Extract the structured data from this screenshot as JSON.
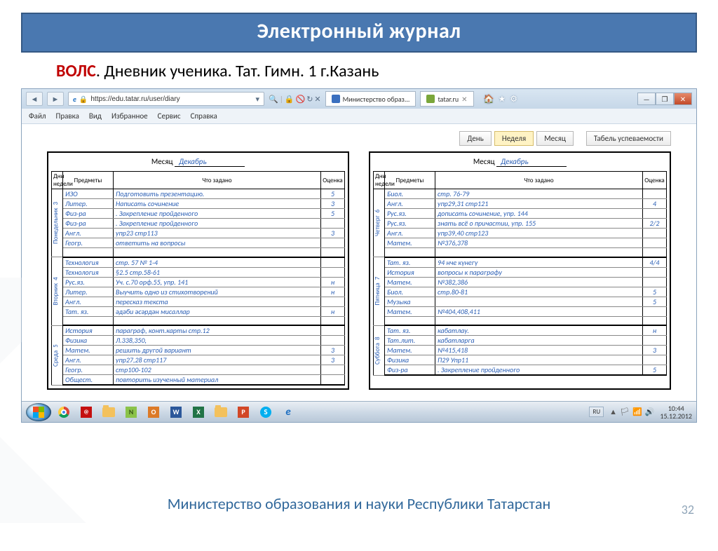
{
  "slide": {
    "title": "Электронный журнал",
    "subtitle_red": "ВОЛС",
    "subtitle_rest": ".  Дневник ученика. Тат. Гимн. 1  г.Казань",
    "footer": "Министерство образования и науки Республики Татарстан",
    "number": "32"
  },
  "browser": {
    "url": "https://edu.tatar.ru/user/diary",
    "tabs": [
      {
        "label": "Министерство образ..."
      },
      {
        "label": "tatar.ru"
      }
    ],
    "menu": [
      "Файл",
      "Правка",
      "Вид",
      "Избранное",
      "Сервис",
      "Справка"
    ],
    "view_buttons": {
      "day": "День",
      "week": "Неделя",
      "month": "Месяц",
      "report": "Табель успеваемости"
    },
    "month_label": "Месяц",
    "month_value": "Декабрь",
    "headers": {
      "day": "Дни недели",
      "subject": "Предметы",
      "task": "Что задано",
      "grade": "Оценка"
    }
  },
  "left_page": [
    {
      "day": "Понедельник",
      "num": "3",
      "rows": [
        {
          "s": "ИЗО",
          "t": "Подготовить презентацию.",
          "g": "5"
        },
        {
          "s": "Литер.",
          "t": "Написать сочинение",
          "g": "3"
        },
        {
          "s": "Физ-ра",
          "t": ". Закрепление пройденного",
          "g": "5"
        },
        {
          "s": "Физ-ра",
          "t": ". Закрепление пройденного",
          "g": ""
        },
        {
          "s": "Англ.",
          "t": "упр23 стр113",
          "g": "3"
        },
        {
          "s": "Геогр.",
          "t": "ответить на вопросы",
          "g": ""
        },
        {
          "s": "",
          "t": "",
          "g": ""
        }
      ]
    },
    {
      "day": "Вторник",
      "num": "4",
      "rows": [
        {
          "s": "Технология",
          "t": "стр. 57 № 1-4",
          "g": ""
        },
        {
          "s": "Технология",
          "t": "§2.5 стр.58-61",
          "g": ""
        },
        {
          "s": "Рус.яз.",
          "t": "Уч. с.70 орф.55, упр. 141",
          "g": "н"
        },
        {
          "s": "Литер.",
          "t": "Выучить одно из стихотворений",
          "g": "н"
        },
        {
          "s": "Англ.",
          "t": "пересказ текста",
          "g": ""
        },
        {
          "s": "Тат. яз.",
          "t": "әдәби әсәрдән мисаллар",
          "g": "н"
        },
        {
          "s": "",
          "t": "",
          "g": ""
        }
      ]
    },
    {
      "day": "Среда",
      "num": "5",
      "rows": [
        {
          "s": "История",
          "t": "параграф, конт.карты стр.12",
          "g": ""
        },
        {
          "s": "Физика",
          "t": "Л.338,350,",
          "g": ""
        },
        {
          "s": "Матем.",
          "t": "решить другой вариант",
          "g": "3"
        },
        {
          "s": "Англ.",
          "t": "упр27,28 стр117",
          "g": "3"
        },
        {
          "s": "Геогр.",
          "t": "стр100-102",
          "g": ""
        },
        {
          "s": "Общест.",
          "t": "повторить изученный материал",
          "g": ""
        }
      ]
    }
  ],
  "right_page": [
    {
      "day": "Четверг",
      "num": "6",
      "rows": [
        {
          "s": "Биол.",
          "t": "стр. 76-79",
          "g": ""
        },
        {
          "s": "Англ.",
          "t": "упр29,31 стр121",
          "g": "4"
        },
        {
          "s": "Рус.яз.",
          "t": "дописать сочинение, упр. 144",
          "g": ""
        },
        {
          "s": "Рус.яз.",
          "t": "знать всё о причастии, упр. 155",
          "g": "2/2"
        },
        {
          "s": "Англ.",
          "t": "упр39,40 стр123",
          "g": ""
        },
        {
          "s": "Матем.",
          "t": "№376,378",
          "g": ""
        },
        {
          "s": "",
          "t": "",
          "g": ""
        }
      ]
    },
    {
      "day": "Пятница",
      "num": "7",
      "rows": [
        {
          "s": "Тат. яз.",
          "t": "94 нче күнегү",
          "g": "4/4"
        },
        {
          "s": "История",
          "t": "вопросы к параграфу",
          "g": ""
        },
        {
          "s": "Матем.",
          "t": "№382,386",
          "g": ""
        },
        {
          "s": "Биол.",
          "t": "стр.80-81",
          "g": "5"
        },
        {
          "s": "Музыка",
          "t": "",
          "g": "5"
        },
        {
          "s": "Матем.",
          "t": "№404,408,411",
          "g": ""
        },
        {
          "s": "",
          "t": "",
          "g": ""
        }
      ]
    },
    {
      "day": "Суббота",
      "num": "8",
      "rows": [
        {
          "s": "Тат. яз.",
          "t": "кабатлау.",
          "g": "н"
        },
        {
          "s": "Тат.лит.",
          "t": "кабатларга",
          "g": ""
        },
        {
          "s": "Матем.",
          "t": "№415,418",
          "g": "3"
        },
        {
          "s": "Физика",
          "t": "П29 Упр11",
          "g": ""
        },
        {
          "s": "Физ-ра",
          "t": ". Закрепление пройденного",
          "g": "5"
        }
      ]
    }
  ],
  "taskbar": {
    "lang": "RU",
    "time": "10:44",
    "date": "15.12.2012"
  }
}
